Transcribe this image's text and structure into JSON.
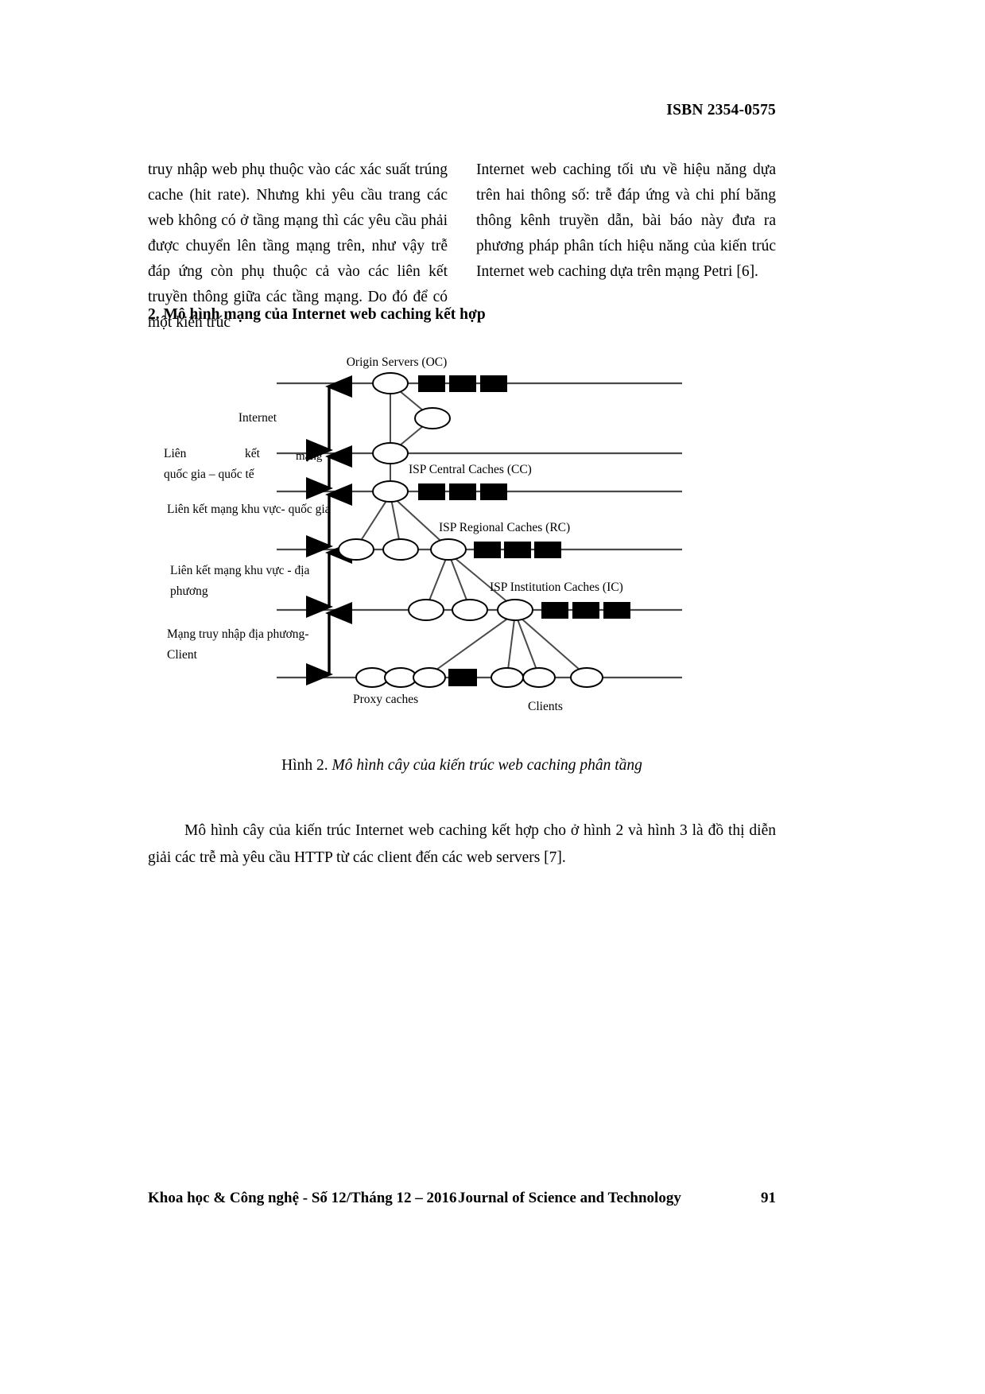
{
  "header": {
    "isbn": "ISBN 2354-0575"
  },
  "body": {
    "left_column": "truy nhập web phụ thuộc vào các xác suất trúng cache (hit rate). Nhưng khi yêu cầu trang các web không có ở tầng mạng thì các yêu cầu phải được chuyển lên tầng mạng trên, như vậy trễ đáp ứng còn phụ thuộc cả vào các liên kết truyền thông giữa các tầng mạng. Do đó để có một kiến trúc",
    "right_column": "Internet web caching tối ưu về hiệu năng dựa trên hai thông số: trễ đáp ứng và chi phí băng thông kênh truyền dẫn, bài báo này đưa ra phương pháp phân tích hiệu năng của kiến trúc Internet web caching dựa trên mạng Petri [6]."
  },
  "section": {
    "heading": "2. Mô hình mạng của Internet web caching kết hợp"
  },
  "figure": {
    "node_labels": {
      "origin_servers": "Origin Servers (OC)",
      "isp_central": "ISP Central Caches (CC)",
      "isp_regional": "ISP Regional Caches (RC)",
      "isp_institution": "ISP Institution Caches (IC)",
      "proxy_caches": "Proxy caches",
      "clients": "Clients"
    },
    "tier_labels": {
      "internet": "Internet",
      "national_1": "Liên",
      "national_2": "kết",
      "national_3": "mạng",
      "national_4": "quốc gia – quốc tế",
      "regional_national": "Liên kết mạng khu vực- quốc gia",
      "regional_local_1": "Liên kết mạng khu vực - địa",
      "regional_local_2": "phương",
      "access_1": "Mạng truy nhập địa phương-",
      "access_2": "Client"
    },
    "caption_prefix": "Hình 2. ",
    "caption_italic": "Mô hình cây của kiến trúc web caching phân tầng"
  },
  "trailing": {
    "paragraph": "Mô hình cây của kiến trúc Internet web caching kết hợp cho ở hình 2 và hình 3 là đồ thị diễn giải các trễ mà yêu cầu HTTP từ các client đến các web servers [7]."
  },
  "footer": {
    "left": "Khoa học & Công nghệ - Số 12/Tháng 12 – 2016",
    "center": "Journal of Science and Technology",
    "page_number": "91"
  },
  "colors": {
    "text": "#000000",
    "background": "#ffffff",
    "diagram_line": "#4a4a4a",
    "diagram_fill": "#000000"
  }
}
